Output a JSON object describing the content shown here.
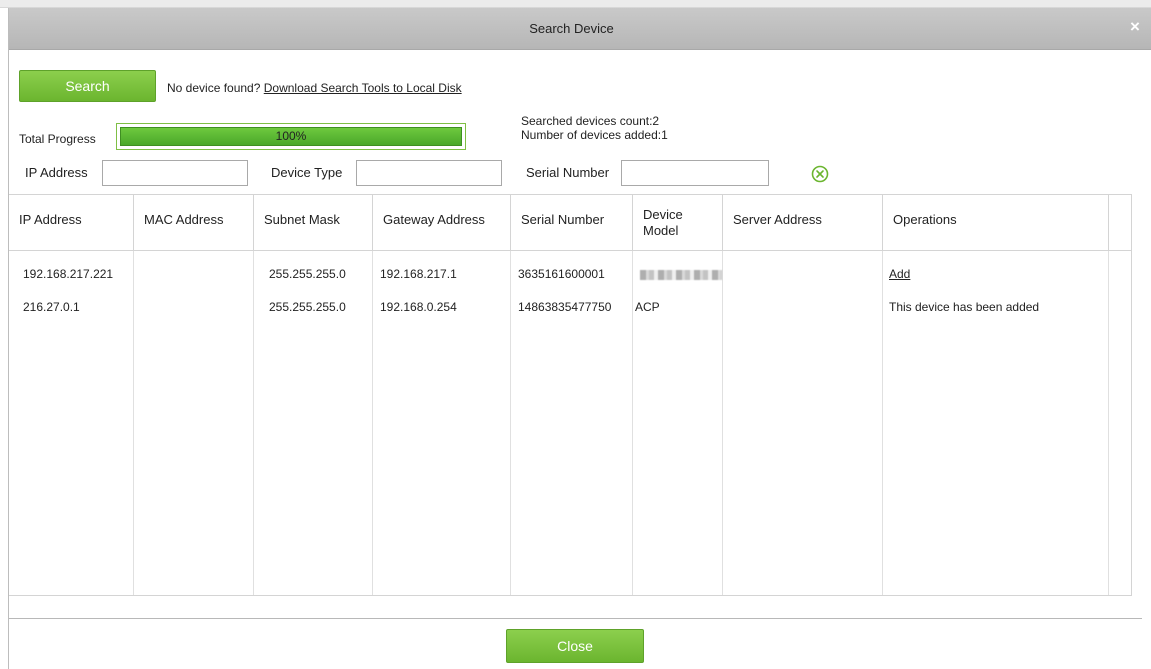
{
  "dialog": {
    "title": "Search Device",
    "close_icon": "close-x-icon"
  },
  "search": {
    "button_label": "Search",
    "no_device_text": "No device found?",
    "download_link": "Download Search Tools to Local Disk"
  },
  "progress": {
    "label": "Total Progress",
    "percent_text": "100%",
    "value_percent": 100,
    "searched_count": "Searched devices count:2",
    "added_count": "Number of devices added:1"
  },
  "filters": {
    "ip_label": "IP Address",
    "ip_value": "",
    "type_label": "Device Type",
    "type_value": "",
    "serial_label": "Serial Number",
    "serial_value": "",
    "clear_icon": "clear-filter-icon"
  },
  "table": {
    "columns": [
      "IP Address",
      "MAC Address",
      "Subnet Mask",
      "Gateway Address",
      "Serial Number",
      "Device Model",
      "Server Address",
      "Operations"
    ],
    "rows": [
      {
        "ip": "192.168.217.221",
        "mac": "",
        "subnet": "255.255.255.0",
        "gateway": "192.168.217.1",
        "serial": "3635161600001",
        "model": "",
        "server": "",
        "operation": "Add"
      },
      {
        "ip": "216.27.0.1",
        "mac": "",
        "subnet": "255.255.255.0",
        "gateway": "192.168.0.254",
        "serial": "14863835477750",
        "model": "ACP",
        "server": "",
        "operation": "This device has been added"
      }
    ]
  },
  "footer": {
    "close_label": "Close"
  },
  "colors": {
    "accent_green": "#6bb52f",
    "titlebar": "#c0c0c0"
  }
}
